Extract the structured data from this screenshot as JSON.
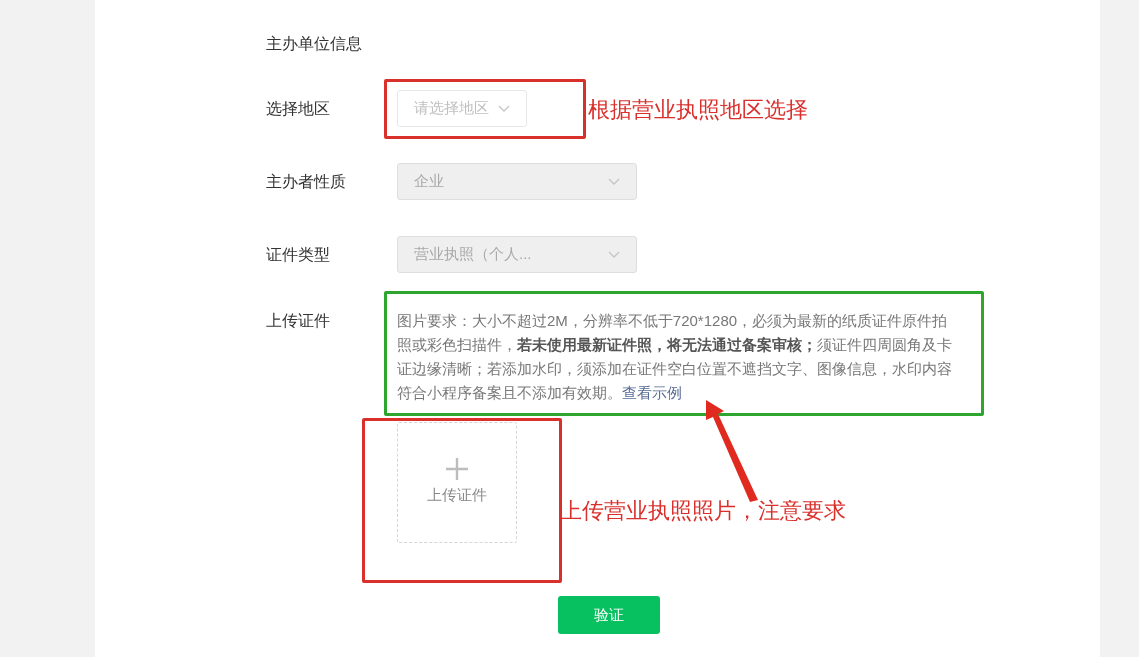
{
  "section_title": "主办单位信息",
  "fields": [
    {
      "kind": "select",
      "label": "选择地区",
      "placeholder": "请选择地区",
      "disabled": false
    },
    {
      "kind": "select",
      "label": "主办者性质",
      "value": "企业",
      "disabled": true
    },
    {
      "kind": "select",
      "label": "证件类型",
      "value": "营业执照（个人...",
      "disabled": true
    }
  ],
  "upload": {
    "label": "上传证件",
    "requirements": "图片要求：大小不超过2M，分辨率不低于720*1280，必须为最新的纸质证件原件拍照或彩色扫描件，**若未使用最新证件照，将无法通过备案审核；**须证件四周圆角及卡证边缘清晰；若添加水印，须添加在证件空白位置不遮挡文字、图像信息，水印内容符合小程序备案且不添加有效期。",
    "example_link": "查看示例",
    "upload_button": "上传证件"
  },
  "submit_button": "验证",
  "annotations": [
    {
      "kind": "box",
      "color": "#d9302c"
    },
    {
      "kind": "note",
      "text": "根据营业执照地区选择"
    },
    {
      "kind": "box",
      "color": "#2ea52e"
    },
    {
      "kind": "box",
      "color": "#d9302c"
    },
    {
      "kind": "note",
      "text": "上传营业执照照片，注意要求"
    },
    {
      "kind": "arrow"
    }
  ]
}
